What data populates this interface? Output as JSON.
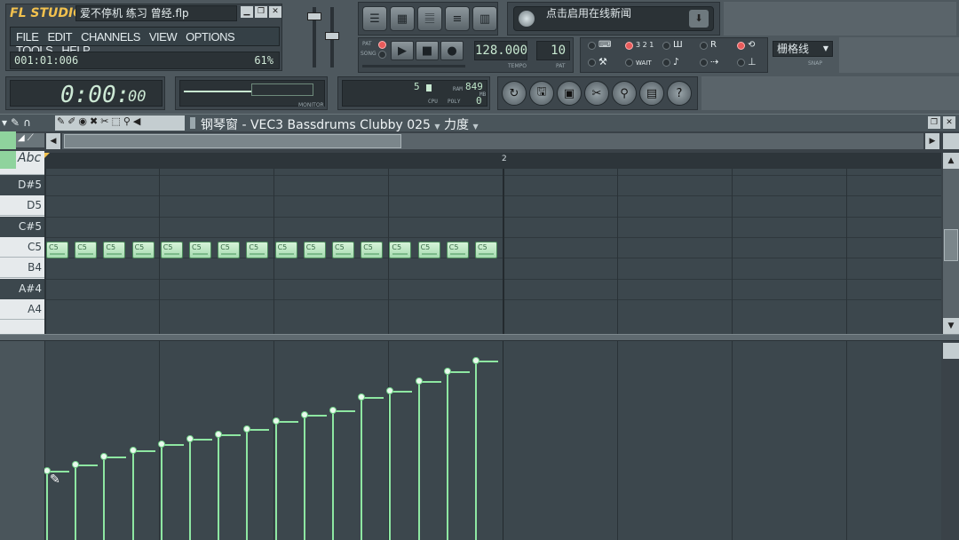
{
  "app": {
    "logo": "FL STUDIO",
    "project_title": "爱不停机 练习 曾经.flp"
  },
  "menu": [
    "FILE",
    "EDIT",
    "CHANNELS",
    "VIEW",
    "OPTIONS",
    "TOOLS",
    "HELP"
  ],
  "hint_bar": {
    "position": "001:01:006",
    "percent": "61%"
  },
  "time_display": {
    "time": "0:00:",
    "ms": "00"
  },
  "transport": {
    "pat_label": "PAT",
    "song_label": "SONG",
    "tempo": "128.000",
    "tempo_label": "TEMPO",
    "pattern": "10",
    "pattern_label": "PAT"
  },
  "cpu": {
    "value": "5",
    "poly": "849",
    "ram_label": "RAM",
    "mb_label": "MB",
    "cpu_label": "CPU",
    "poly_label": "POLY",
    "poly_value": "0"
  },
  "monitor_label": "MONITOR",
  "news": {
    "text": "点击启用在线新闻"
  },
  "snap": {
    "value": "栅格线",
    "label": "SNAP"
  },
  "toolbar_misc": {
    "count_label": "3 2 1",
    "wait_label": "WAIT"
  },
  "piano_roll": {
    "title": "钢琴窗 - VEC3 Bassdrums Clubby 025",
    "velocity_label": "力度",
    "abc_label": "Abc",
    "bar_marker": "2",
    "keys": [
      {
        "name": "D#5",
        "black": true
      },
      {
        "name": "D5",
        "black": false
      },
      {
        "name": "C#5",
        "black": true
      },
      {
        "name": "C5",
        "black": false
      },
      {
        "name": "B4",
        "black": false
      },
      {
        "name": "A#4",
        "black": true
      },
      {
        "name": "A4",
        "black": false
      }
    ],
    "note_label": "C5",
    "note_count": 16,
    "velocities": [
      0.35,
      0.38,
      0.42,
      0.45,
      0.48,
      0.51,
      0.53,
      0.56,
      0.6,
      0.63,
      0.65,
      0.72,
      0.75,
      0.8,
      0.85,
      0.9
    ]
  },
  "colors": {
    "accent_green": "#8ee7a2",
    "note_fill": "#bde7c3",
    "panel": "#4e585e"
  }
}
